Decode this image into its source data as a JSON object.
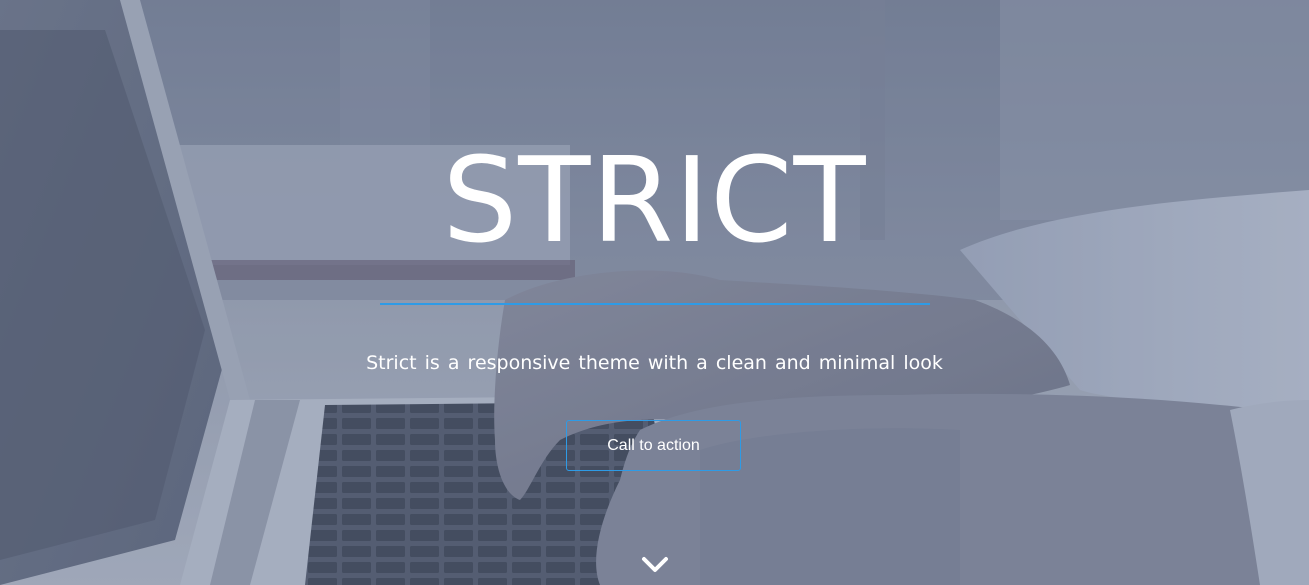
{
  "hero": {
    "title": "STRICT",
    "tagline": "Strict is a responsive theme with a clean and minimal look",
    "cta_label": "Call to action",
    "scroll_icon": "chevron-down-icon"
  },
  "colors": {
    "accent": "#2e9be6",
    "text": "#ffffff",
    "overlay": "#606e8c"
  }
}
